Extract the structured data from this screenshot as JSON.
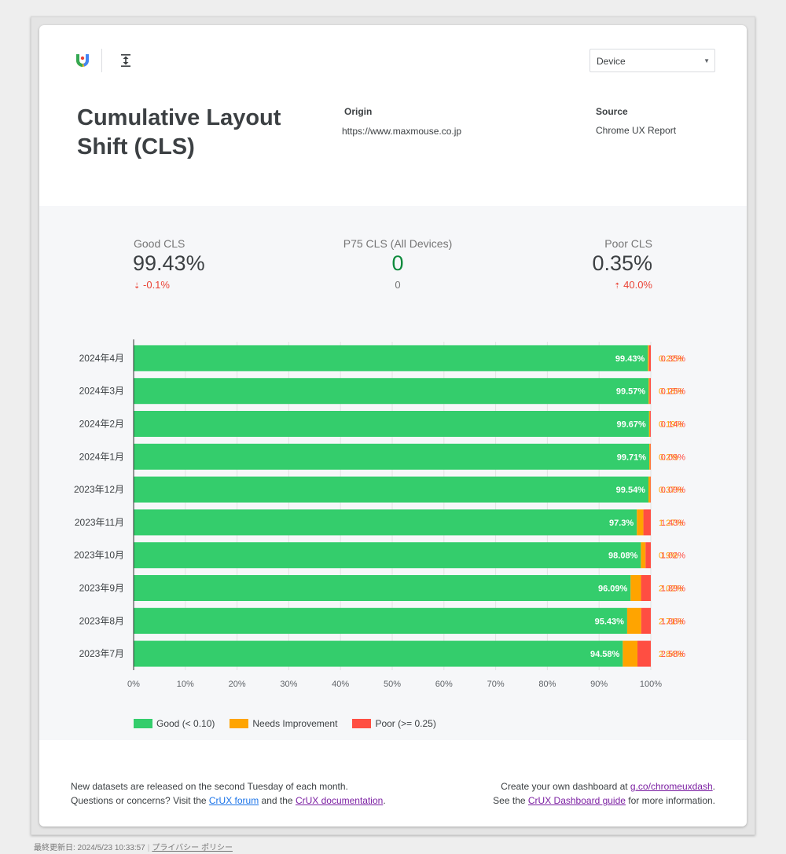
{
  "header": {
    "device_select": "Device",
    "title": "Cumulative Layout Shift (CLS)",
    "origin_label": "Origin",
    "origin_value": "https://www.maxmouse.co.jp",
    "source_label": "Source",
    "source_value": "Chrome UX Report"
  },
  "stats": {
    "good": {
      "label": "Good CLS",
      "value": "99.43%",
      "change": "-0.1%"
    },
    "p75": {
      "label": "P75 CLS (All Devices)",
      "value": "0",
      "sub": "0"
    },
    "poor": {
      "label": "Poor CLS",
      "value": "0.35%",
      "change": "40.0%"
    }
  },
  "chart_data": {
    "type": "bar",
    "orientation": "horizontal",
    "stacked": true,
    "categories": [
      "2024年4月",
      "2024年3月",
      "2024年2月",
      "2024年1月",
      "2023年12月",
      "2023年11月",
      "2023年10月",
      "2023年9月",
      "2023年8月",
      "2023年7月"
    ],
    "series": [
      {
        "name": "Good (< 0.10)",
        "color": "#34cd6c",
        "values": [
          99.43,
          99.57,
          99.67,
          99.71,
          99.54,
          97.3,
          98.08,
          96.09,
          95.43,
          94.58
        ]
      },
      {
        "name": "Needs Improvement",
        "color": "#ffa400",
        "values": [
          0.22,
          0.18,
          0.19,
          0.2,
          0.37,
          1.27,
          0.9,
          2.02,
          2.71,
          2.84
        ]
      },
      {
        "name": "Poor (>= 0.25)",
        "color": "#ff4e42",
        "values": [
          0.35,
          0.25,
          0.14,
          0.09,
          0.09,
          1.43,
          1.02,
          1.89,
          1.86,
          2.58
        ]
      }
    ],
    "data_labels": {
      "good": [
        "99.43%",
        "99.57%",
        "99.67%",
        "99.71%",
        "99.54%",
        "97.3%",
        "98.08%",
        "96.09%",
        "95.43%",
        "94.58%"
      ],
      "ni": [
        "0.22%",
        "0.18%",
        "0.19%",
        "0.2%",
        "0.37%",
        "1.27%",
        "0.9%",
        "2.02%",
        "2.71%",
        "2.84%"
      ],
      "poor": [
        "0.35%",
        "0.25%",
        "0.14%",
        "0.09%",
        "0.09%",
        "1.43%",
        "1.02%",
        "1.89%",
        "1.86%",
        "2.58%"
      ]
    },
    "xlim": [
      0,
      100
    ],
    "x_ticks": [
      "0%",
      "10%",
      "20%",
      "30%",
      "40%",
      "50%",
      "60%",
      "70%",
      "80%",
      "90%",
      "100%"
    ],
    "grid": true,
    "legend_position": "bottom-left"
  },
  "footer": {
    "line1": "New datasets are released on the second Tuesday of each month.",
    "line2_prefix": "Questions or concerns? Visit the ",
    "forum_link": "CrUX forum",
    "line2_mid": " and the ",
    "docs_link": "CrUX documentation",
    "line2_suffix": ".",
    "right_line1_prefix": "Create your own dashboard at ",
    "dash_link": "g.co/chromeuxdash",
    "right_line1_suffix": ".",
    "right_line2_prefix": "See the ",
    "guide_link": "CrUX Dashboard guide",
    "right_line2_suffix": " for more information."
  },
  "bottom": {
    "updated": "最終更新日: 2024/5/23 10:33:57",
    "privacy": "プライバシー ポリシー"
  }
}
